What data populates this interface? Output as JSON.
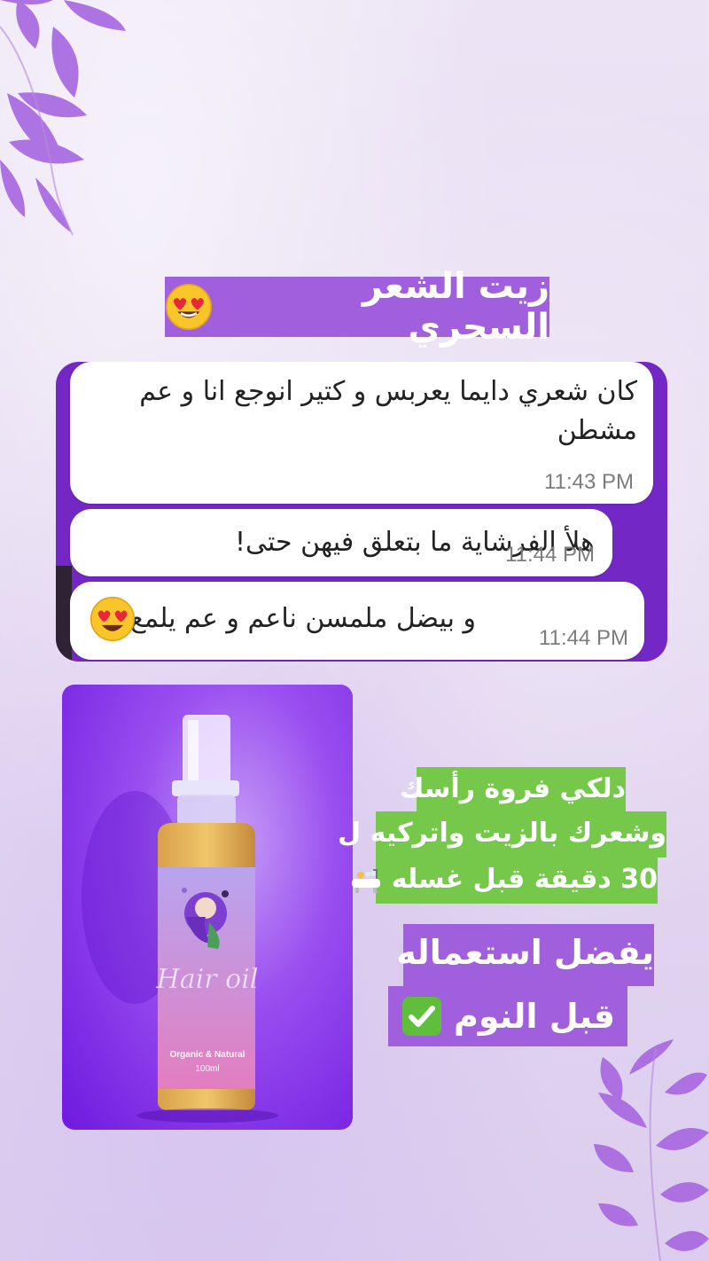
{
  "title": {
    "text": "زيت الشعر السحري",
    "emoji": "heart-eyes-emoji"
  },
  "chat": {
    "messages": [
      {
        "text": "كان شعري دايما يعربس و كتير انوجع انا و عم مشطن",
        "time": "11:43 PM"
      },
      {
        "text": "هلأ الفرشاية ما بتعلق فيهن حتى!",
        "time": "11:44 PM"
      },
      {
        "text": "و بيضل ملمسن ناعم و عم يلمع",
        "time": "11:44 PM",
        "emoji": "heart-eyes-emoji"
      }
    ]
  },
  "product": {
    "label": "Hair oil",
    "subtitle": "Organic & Natural",
    "volume": "100ml"
  },
  "tip": {
    "lines": [
      "دلكي فروة رأسك",
      "وشعرك بالزيت واتركيه ل",
      "30 دقيقة قبل غسله"
    ],
    "icon": "bathtub-icon"
  },
  "usage": {
    "lines": [
      "يفضل استعماله",
      "قبل النوم"
    ],
    "icon": "check-mark-icon"
  },
  "colors": {
    "accent_purple": "#a05fdc",
    "chat_purple": "#7328c5",
    "tip_green": "#75c84a"
  }
}
